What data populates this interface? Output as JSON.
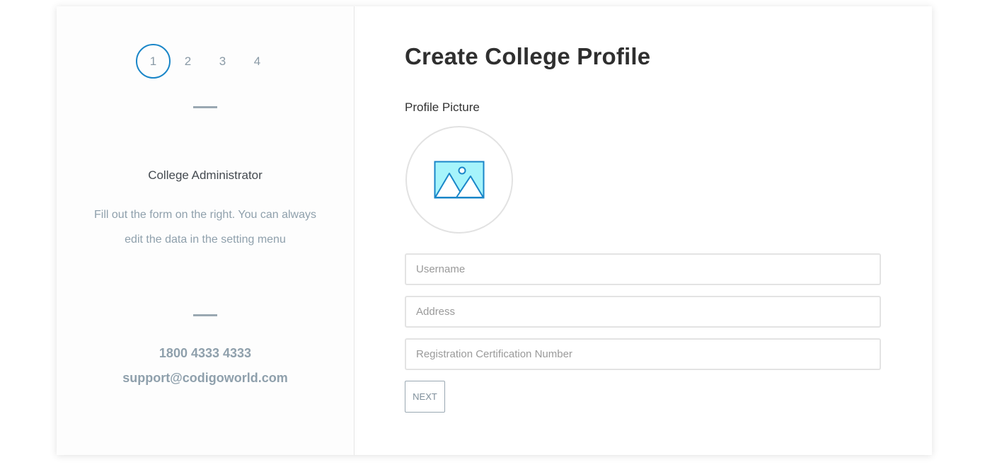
{
  "steps": [
    "1",
    "2",
    "3",
    "4"
  ],
  "active_step": "1",
  "sidebar": {
    "role_title": "College Administrator",
    "description": "Fill out the form on the right. You can always edit the data in the setting menu",
    "phone": "1800 4333 4333",
    "email": "support@codigoworld.com"
  },
  "form": {
    "title": "Create College Profile",
    "picture_label": "Profile Picture",
    "picture_icon": "image-placeholder-icon",
    "fields": {
      "username_placeholder": "Username",
      "address_placeholder": "Address",
      "registration_placeholder": "Registration Certification Number"
    },
    "next_label": "NEXT"
  },
  "colors": {
    "accent": "#1a86c8",
    "icon_fill": "#a6f4fb",
    "muted_text": "#8fa0ac"
  }
}
